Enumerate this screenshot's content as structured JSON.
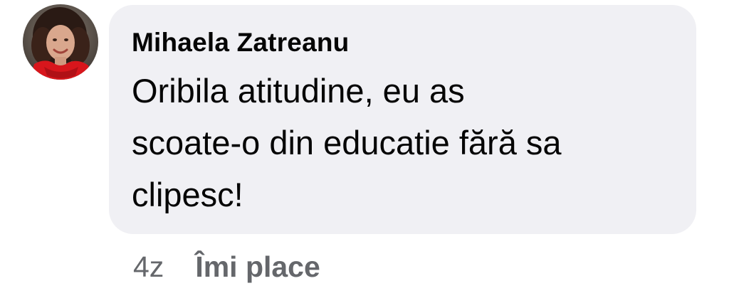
{
  "comment": {
    "author": "Mihaela Zatreanu",
    "text": "Oribila atitudine, eu as\nscoate-o din educatie fără sa\nclipesc!",
    "time": "4z",
    "like_label": "Îmi place"
  },
  "avatar": {
    "icon": "profile-photo"
  },
  "colors": {
    "bubble_bg": "#f0f0f4",
    "text": "#050505",
    "meta": "#65676b"
  }
}
